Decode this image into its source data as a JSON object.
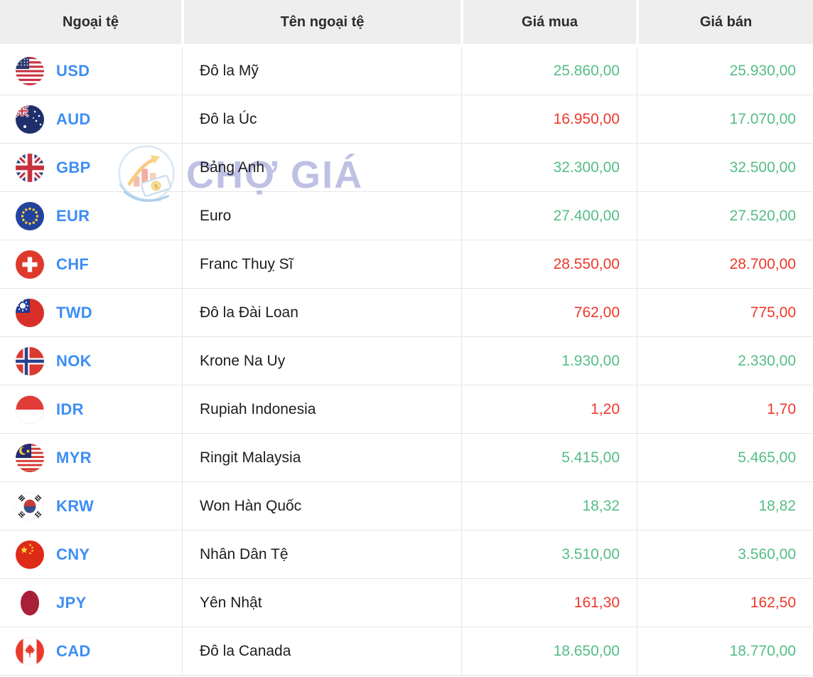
{
  "watermark": {
    "text": "CHỢ GIÁ"
  },
  "table": {
    "headers": [
      "Ngoại tệ",
      "Tên ngoại tệ",
      "Giá mua",
      "Giá bán"
    ],
    "rows": [
      {
        "code": "USD",
        "name": "Đô la Mỹ",
        "buy": "25.860,00",
        "sell": "25.930,00",
        "buy_trend": "up",
        "sell_trend": "up",
        "flag": "us"
      },
      {
        "code": "AUD",
        "name": "Đô la Úc",
        "buy": "16.950,00",
        "sell": "17.070,00",
        "buy_trend": "down",
        "sell_trend": "up",
        "flag": "au"
      },
      {
        "code": "GBP",
        "name": "Bảng Anh",
        "buy": "32.300,00",
        "sell": "32.500,00",
        "buy_trend": "up",
        "sell_trend": "up",
        "flag": "gb"
      },
      {
        "code": "EUR",
        "name": "Euro",
        "buy": "27.400,00",
        "sell": "27.520,00",
        "buy_trend": "up",
        "sell_trend": "up",
        "flag": "eu"
      },
      {
        "code": "CHF",
        "name": "Franc Thuỵ Sĩ",
        "buy": "28.550,00",
        "sell": "28.700,00",
        "buy_trend": "down",
        "sell_trend": "down",
        "flag": "ch"
      },
      {
        "code": "TWD",
        "name": "Đô la Đài Loan",
        "buy": "762,00",
        "sell": "775,00",
        "buy_trend": "down",
        "sell_trend": "down",
        "flag": "tw"
      },
      {
        "code": "NOK",
        "name": "Krone Na Uy",
        "buy": "1.930,00",
        "sell": "2.330,00",
        "buy_trend": "up",
        "sell_trend": "up",
        "flag": "no"
      },
      {
        "code": "IDR",
        "name": "Rupiah Indonesia",
        "buy": "1,20",
        "sell": "1,70",
        "buy_trend": "down",
        "sell_trend": "down",
        "flag": "id"
      },
      {
        "code": "MYR",
        "name": "Ringit Malaysia",
        "buy": "5.415,00",
        "sell": "5.465,00",
        "buy_trend": "up",
        "sell_trend": "up",
        "flag": "my"
      },
      {
        "code": "KRW",
        "name": "Won Hàn Quốc",
        "buy": "18,32",
        "sell": "18,82",
        "buy_trend": "up",
        "sell_trend": "up",
        "flag": "kr"
      },
      {
        "code": "CNY",
        "name": "Nhân Dân Tệ",
        "buy": "3.510,00",
        "sell": "3.560,00",
        "buy_trend": "up",
        "sell_trend": "up",
        "flag": "cn"
      },
      {
        "code": "JPY",
        "name": "Yên Nhật",
        "buy": "161,30",
        "sell": "162,50",
        "buy_trend": "down",
        "sell_trend": "down",
        "flag": "jp"
      },
      {
        "code": "CAD",
        "name": "Đô la Canada",
        "buy": "18.650,00",
        "sell": "18.770,00",
        "buy_trend": "up",
        "sell_trend": "up",
        "flag": "ca"
      }
    ]
  },
  "colors": {
    "up_green": "#55bd86",
    "down_red": "#ec382b",
    "code_blue": "#3d8ef5",
    "header_bg": "#eeeeee",
    "watermark_text": "#b3b6e0"
  }
}
